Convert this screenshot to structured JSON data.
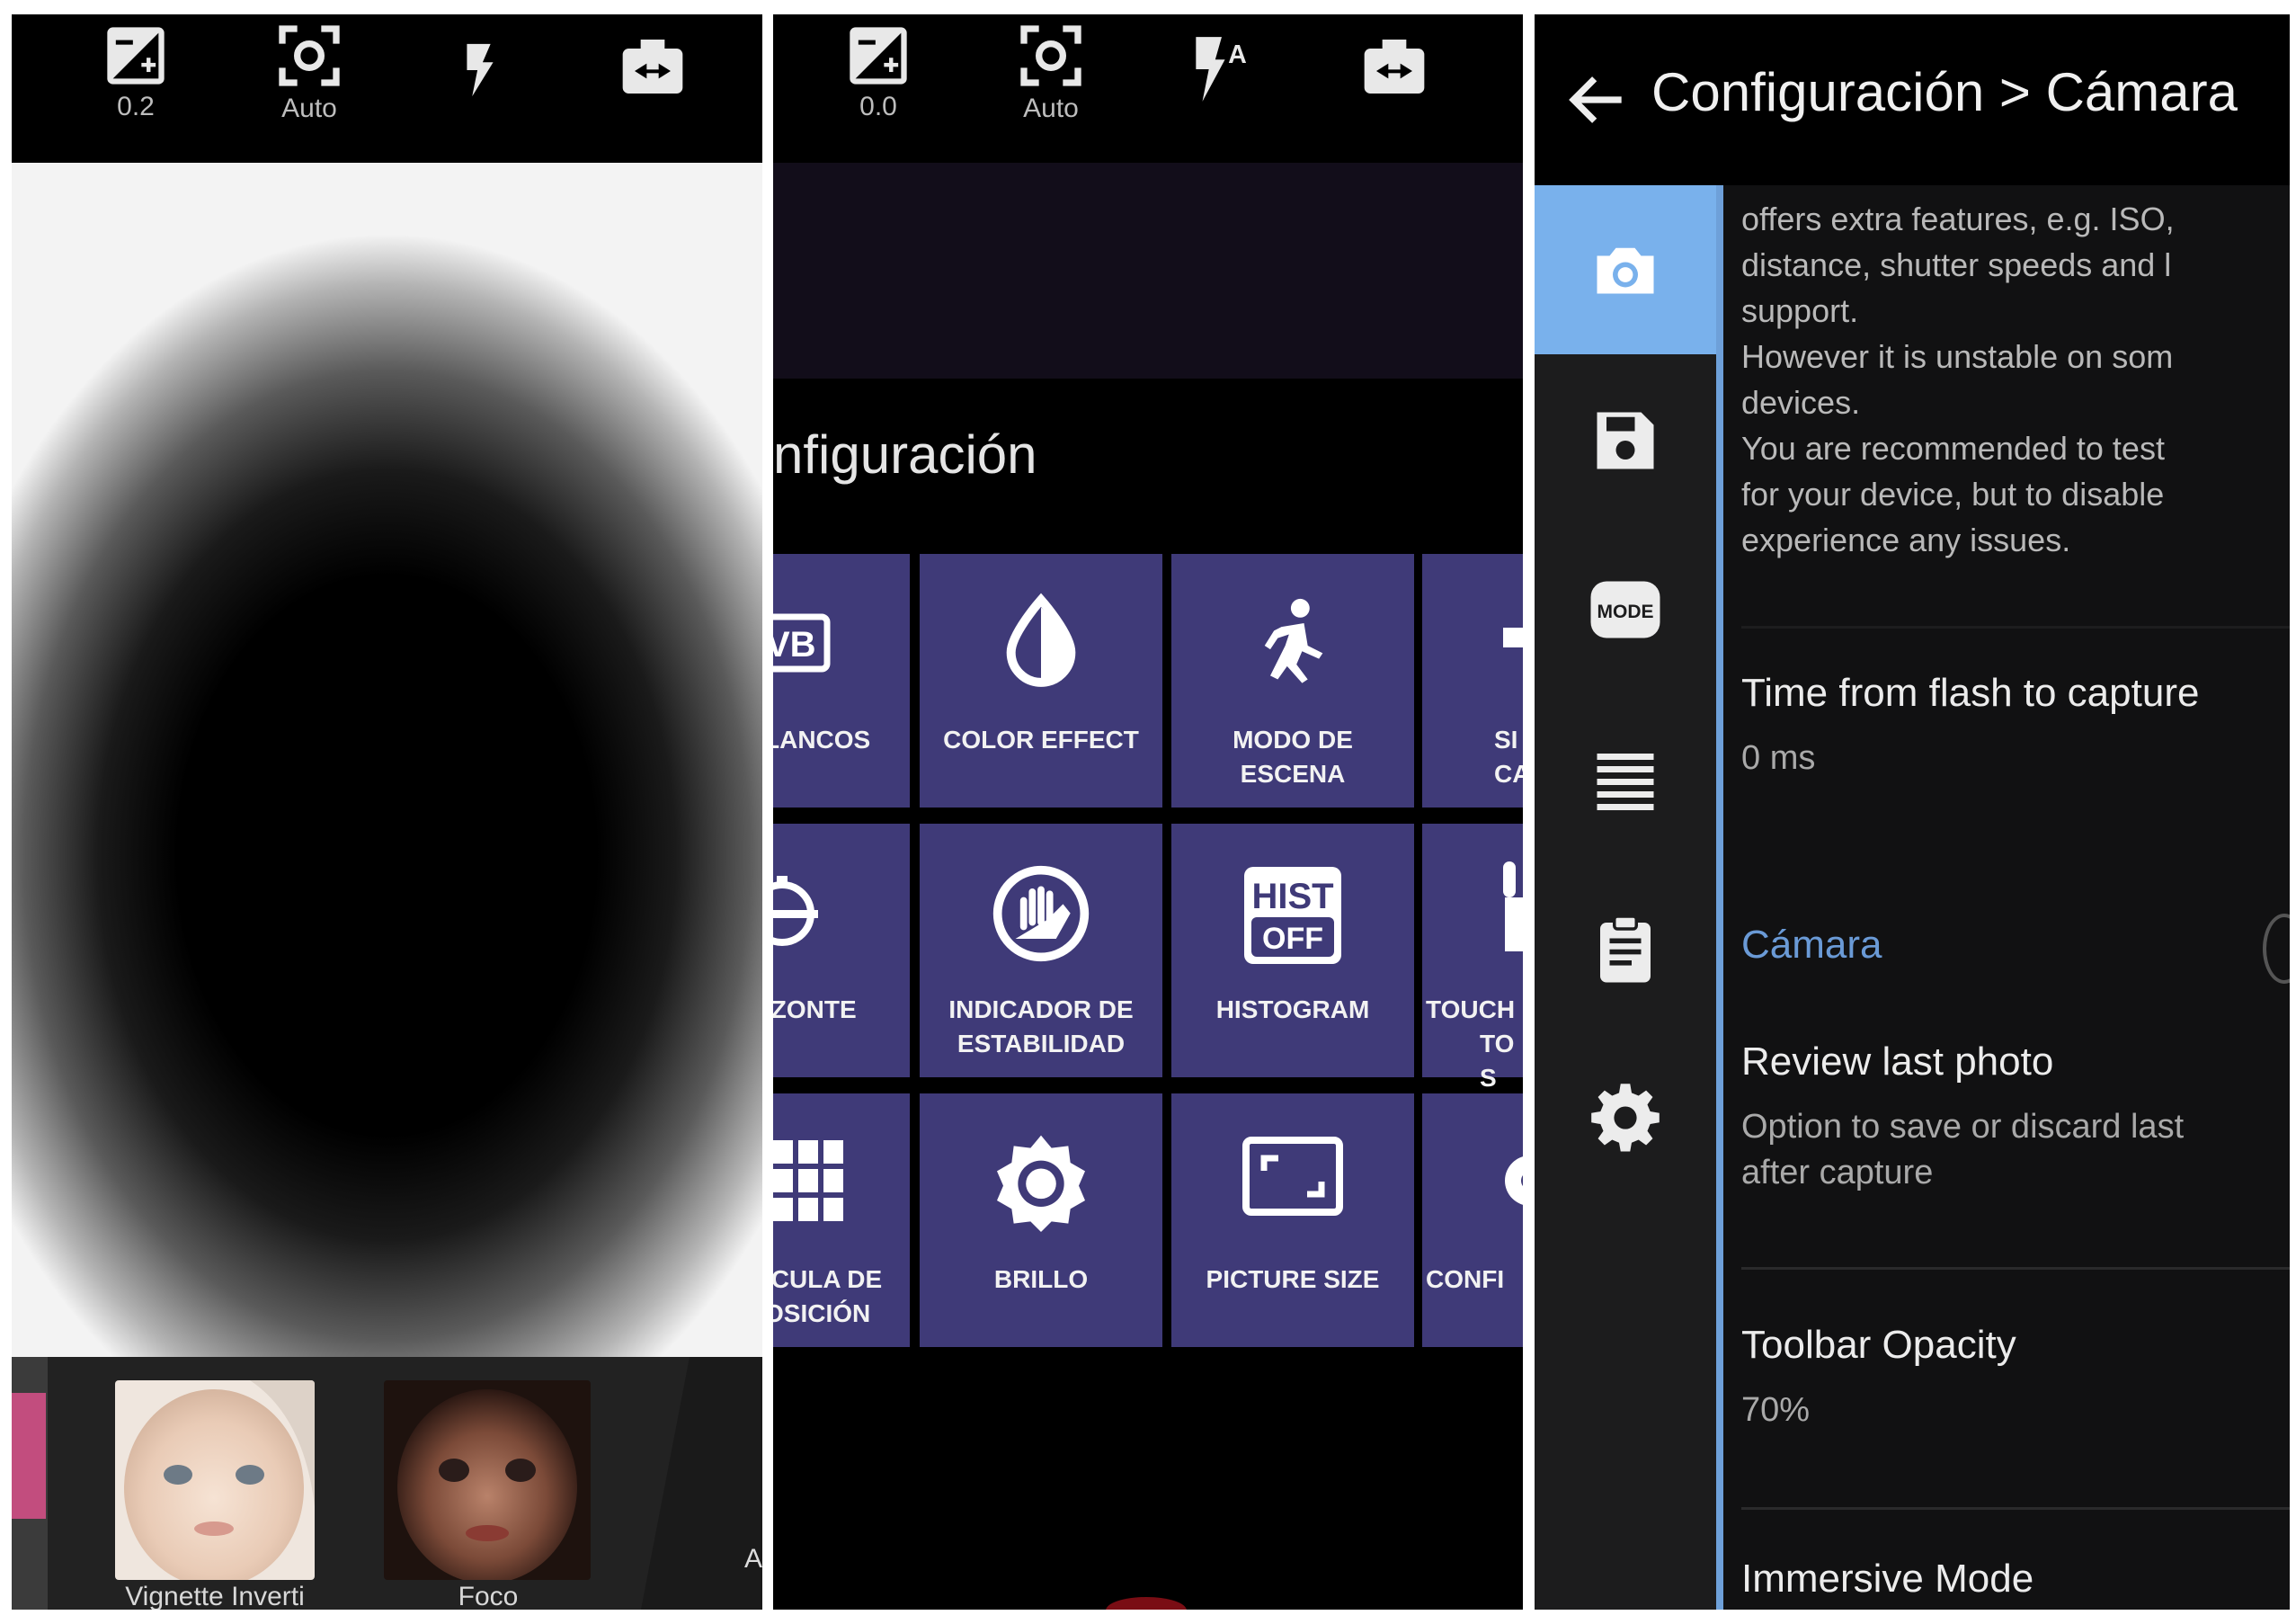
{
  "panel1": {
    "toolbar": [
      {
        "icon": "exposure-icon",
        "label": "0.2"
      },
      {
        "icon": "focus-icon",
        "label": "Auto"
      },
      {
        "icon": "flash-icon",
        "label": ""
      },
      {
        "icon": "camera-switch-icon",
        "label": ""
      }
    ],
    "filters": [
      {
        "label": "Vignette Inverti"
      },
      {
        "label": "Foco"
      }
    ],
    "strip_edge_label": "A"
  },
  "panel2": {
    "toolbar": [
      {
        "icon": "exposure-icon",
        "label": "0.0"
      },
      {
        "icon": "focus-icon",
        "label": "Auto"
      },
      {
        "icon": "flash-auto-icon",
        "label": ""
      },
      {
        "icon": "camera-switch-icon",
        "label": ""
      }
    ],
    "title": "nfiguración",
    "tiles": [
      {
        "icon": "white-balance-icon",
        "line1": "LANCOS",
        "line2": ""
      },
      {
        "icon": "color-effect-icon",
        "line1": "COLOR EFFECT",
        "line2": ""
      },
      {
        "icon": "scene-mode-icon",
        "line1": "MODO DE",
        "line2": "ESCENA"
      },
      {
        "icon": "partial-tile-icon",
        "line1": "SI",
        "line2": "CA"
      },
      {
        "icon": "horizon-icon",
        "line1": "IZONTE",
        "line2": ""
      },
      {
        "icon": "stability-icon",
        "line1": "INDICADOR DE",
        "line2": "ESTABILIDAD"
      },
      {
        "icon": "histogram-icon",
        "line1": "HISTOGRAM",
        "line2": ""
      },
      {
        "icon": "touch-icon",
        "line1": "TOUCH",
        "line2": "TO S"
      },
      {
        "icon": "grid-icon",
        "line1": "ÍCULA DE",
        "line2": "OSICIÓN"
      },
      {
        "icon": "brightness-icon",
        "line1": "BRILLO",
        "line2": ""
      },
      {
        "icon": "picture-size-icon",
        "line1": "PICTURE SIZE",
        "line2": ""
      },
      {
        "icon": "settings-partial-icon",
        "line1": "CONFI",
        "line2": ""
      }
    ]
  },
  "panel3": {
    "title": "Configuración > Cámara",
    "rail": [
      {
        "icon": "camera-icon",
        "active": true
      },
      {
        "icon": "save-icon",
        "active": false
      },
      {
        "icon": "mode-icon",
        "active": false,
        "text": "MODE"
      },
      {
        "icon": "list-icon",
        "active": false
      },
      {
        "icon": "clipboard-icon",
        "active": false
      },
      {
        "icon": "gear-icon",
        "active": false
      }
    ],
    "description_lines": [
      "offers extra features, e.g. ISO,",
      "distance, shutter speeds and l",
      "support.",
      "However it is unstable on som",
      "devices.",
      "You are recommended to test",
      "for your device, but to disable",
      "experience any issues."
    ],
    "pref_flash": {
      "title": "Time from flash to capture",
      "summary": "0 ms"
    },
    "category": "Cámara",
    "pref_review": {
      "title": "Review last photo",
      "summary_line1": "Option to save or discard last",
      "summary_line2": "after capture"
    },
    "pref_opacity": {
      "title": "Toolbar Opacity",
      "summary": "70%"
    },
    "pref_immersive": {
      "title": "Immersive Mode"
    }
  },
  "colors": {
    "tile": "#3f3a78",
    "accent": "#79b1ec",
    "category": "#6a9ad6"
  }
}
